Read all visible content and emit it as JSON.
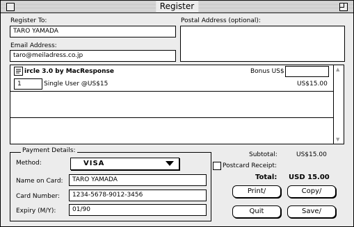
{
  "window": {
    "title": "Register"
  },
  "register_to": {
    "label": "Register To:",
    "value": "TARO YAMADA"
  },
  "email": {
    "label": "Email Address:",
    "value": "taro@meiladress.co.jp"
  },
  "postal": {
    "label": "Postal Address (optional):",
    "value": ""
  },
  "product": {
    "name": "ircle 3.0 by MacResponse",
    "bonus_label": "Bonus US$",
    "bonus_value": "",
    "quantity": "1",
    "license": "Single User @US$15",
    "price": "US$15.00"
  },
  "payment": {
    "group_label": "Payment Details:",
    "method_label": "Method:",
    "method_value": "VISA",
    "name_label": "Name on Card:",
    "name_value": "TARO YAMADA",
    "number_label": "Card Number:",
    "number_value": "1234-5678-9012-3456",
    "expiry_label": "Expiry (M/Y):",
    "expiry_value": "01/90"
  },
  "totals": {
    "subtotal_label": "Subtotal:",
    "subtotal_value": "US$15.00",
    "postcard_label": "Postcard Receipt:",
    "total_label": "Total:",
    "total_value": "USD 15.00"
  },
  "buttons": {
    "print": "Print/",
    "copy": "Copy/",
    "quit": "Quit",
    "save": "Save/"
  }
}
